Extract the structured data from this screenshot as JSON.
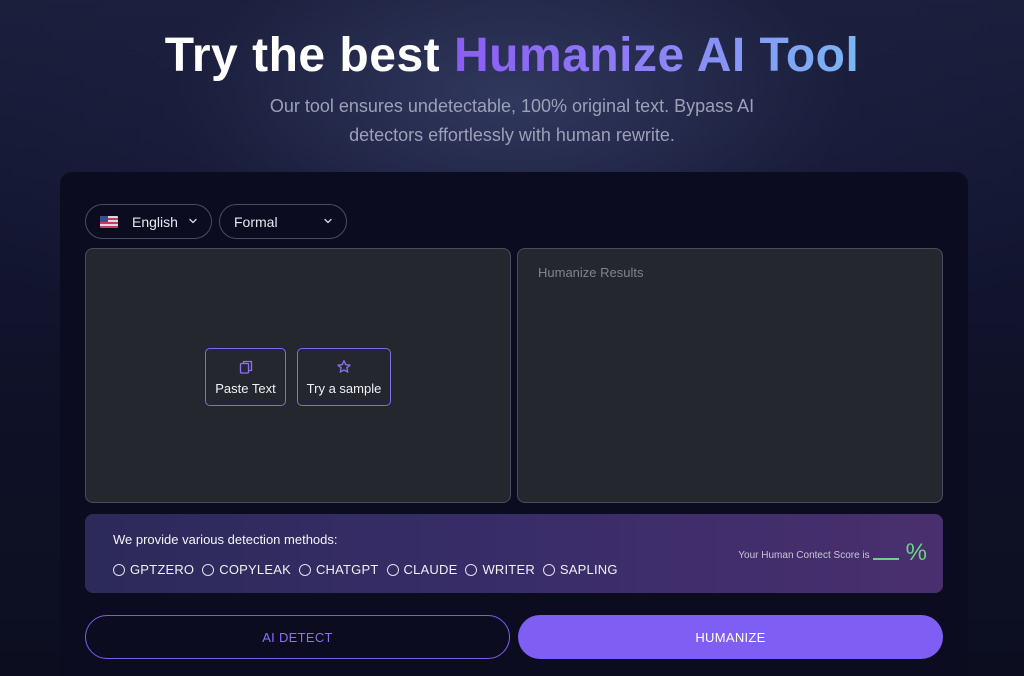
{
  "hero": {
    "title_prefix": "Try the best ",
    "title_highlight": "Humanize AI Tool",
    "subtitle": "Our tool ensures undetectable, 100% original text. Bypass AI detectors effortlessly with human rewrite."
  },
  "controls": {
    "language": "English",
    "language_icon": "us-flag-icon",
    "tone": "Formal"
  },
  "input": {
    "paste_label": "Paste Text",
    "sample_label": "Try a sample"
  },
  "output": {
    "placeholder": "Humanize Results"
  },
  "detection": {
    "title": "We provide various detection methods:",
    "methods": [
      "GPTZERO",
      "COPYLEAK",
      "CHATGPT",
      "CLAUDE",
      "WRITER",
      "SAPLING"
    ],
    "score_label": "Your Human Contect Score is",
    "score_unit": "%"
  },
  "actions": {
    "detect_label": "AI DETECT",
    "humanize_label": "HUMANIZE"
  },
  "colors": {
    "accent": "#7f5ef3",
    "score_green": "#6fd08a"
  }
}
